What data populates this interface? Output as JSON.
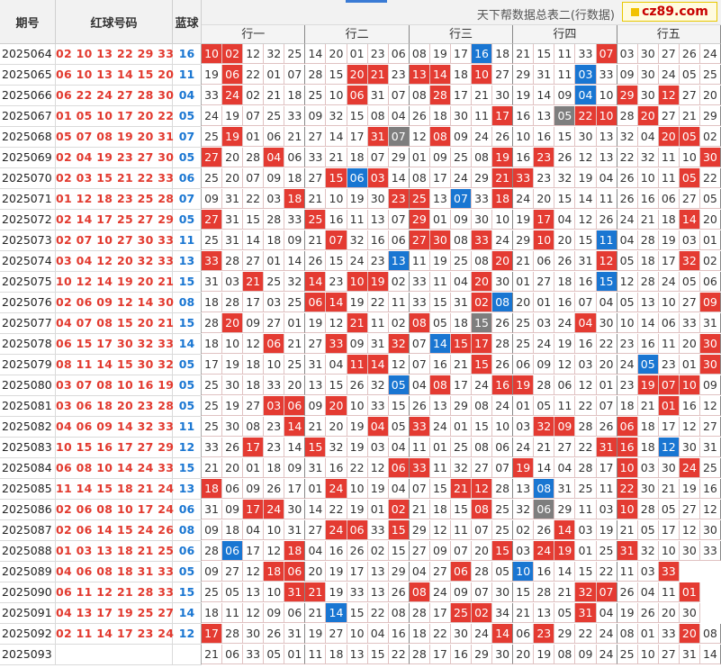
{
  "header": {
    "issue_label": "期号",
    "red_label": "红球号码",
    "blue_label": "蓝球",
    "title": "天下帮数据总表二(行数据)",
    "logo_text": "cz89.com",
    "groups": [
      "行一",
      "行二",
      "行三",
      "行四",
      "行五"
    ]
  },
  "colors": {
    "red_highlight": "#e43b32",
    "blue_highlight": "#1976d2",
    "gray_highlight": "#7e7e7e",
    "red_text": "#e23a2f",
    "blue_text": "#1976d2"
  },
  "rows": [
    {
      "issue": "2025064",
      "red": "02 10 13 22 29 33",
      "blue": "16",
      "cells": [
        "10",
        "02",
        "12",
        "32",
        "25",
        "14",
        "20",
        "01",
        "23",
        "06",
        "08",
        "19",
        "17",
        "16",
        "18",
        "21",
        "15",
        "11",
        "33",
        "07",
        "03",
        "30",
        "27",
        "26",
        "24"
      ],
      "marks": "rr...........b.....r....."
    },
    {
      "issue": "2025065",
      "red": "06 10 13 14 15 20",
      "blue": "11",
      "cells": [
        "19",
        "06",
        "22",
        "01",
        "07",
        "28",
        "15",
        "20",
        "21",
        "23",
        "13",
        "14",
        "18",
        "10",
        "27",
        "29",
        "31",
        "11",
        "03",
        "33",
        "09",
        "30",
        "24",
        "05",
        "25"
      ],
      "marks": ".r.....rr.rr.r....b......"
    },
    {
      "issue": "2025066",
      "red": "06 22 24 27 28 30",
      "blue": "04",
      "cells": [
        "33",
        "24",
        "02",
        "21",
        "18",
        "25",
        "10",
        "06",
        "31",
        "07",
        "08",
        "28",
        "17",
        "21",
        "30",
        "19",
        "14",
        "09",
        "04",
        "10",
        "29",
        "30",
        "12",
        "27",
        "20"
      ],
      "marks": ".r.....r...r......b.r.r."
    },
    {
      "issue": "2025067",
      "red": "01 05 10 17 20 22",
      "blue": "05",
      "cells": [
        "24",
        "19",
        "07",
        "25",
        "33",
        "09",
        "32",
        "15",
        "08",
        "04",
        "26",
        "18",
        "30",
        "11",
        "17",
        "16",
        "13",
        "05",
        "22",
        "10",
        "28",
        "20",
        "27",
        "21",
        "29"
      ],
      "marks": "..............r..grr.r..."
    },
    {
      "issue": "2025068",
      "red": "05 07 08 19 20 31",
      "blue": "07",
      "cells": [
        "25",
        "19",
        "01",
        "06",
        "21",
        "27",
        "14",
        "17",
        "31",
        "07",
        "12",
        "08",
        "09",
        "24",
        "26",
        "10",
        "16",
        "15",
        "30",
        "13",
        "32",
        "04",
        "20",
        "05",
        "02"
      ],
      "marks": ".r......rg.r..........rr."
    },
    {
      "issue": "2025069",
      "red": "02 04 19 23 27 30",
      "blue": "05",
      "cells": [
        "27",
        "20",
        "28",
        "04",
        "06",
        "33",
        "21",
        "18",
        "07",
        "29",
        "01",
        "09",
        "25",
        "08",
        "19",
        "16",
        "23",
        "26",
        "12",
        "13",
        "22",
        "32",
        "11",
        "10",
        "30"
      ],
      "marks": "r..r..........r.r.......r"
    },
    {
      "issue": "2025070",
      "red": "02 03 15 21 22 33",
      "blue": "06",
      "cells": [
        "25",
        "20",
        "07",
        "09",
        "18",
        "27",
        "15",
        "06",
        "03",
        "14",
        "08",
        "17",
        "24",
        "29",
        "21",
        "33",
        "23",
        "32",
        "19",
        "04",
        "26",
        "10",
        "11",
        "05",
        "22"
      ],
      "marks": "......rbr.....rr.......r."
    },
    {
      "issue": "2025071",
      "red": "01 12 18 23 25 28",
      "blue": "07",
      "cells": [
        "09",
        "31",
        "22",
        "03",
        "18",
        "21",
        "10",
        "19",
        "30",
        "23",
        "25",
        "13",
        "07",
        "33",
        "18",
        "24",
        "20",
        "15",
        "14",
        "11",
        "26",
        "16",
        "06",
        "27",
        "05"
      ],
      "marks": "....r....rr.b.r.........."
    },
    {
      "issue": "2025072",
      "red": "02 14 17 25 27 29",
      "blue": "05",
      "cells": [
        "27",
        "31",
        "15",
        "28",
        "33",
        "25",
        "16",
        "11",
        "13",
        "07",
        "29",
        "01",
        "09",
        "30",
        "10",
        "19",
        "17",
        "04",
        "12",
        "26",
        "24",
        "21",
        "18",
        "14",
        "20"
      ],
      "marks": "r....r....r.....r......r."
    },
    {
      "issue": "2025073",
      "red": "02 07 10 27 30 33",
      "blue": "11",
      "cells": [
        "25",
        "31",
        "14",
        "18",
        "09",
        "21",
        "07",
        "32",
        "16",
        "06",
        "27",
        "30",
        "08",
        "33",
        "24",
        "29",
        "10",
        "20",
        "15",
        "11",
        "04",
        "28",
        "19",
        "03",
        "01"
      ],
      "marks": "......r...rr.r..r..b....."
    },
    {
      "issue": "2025074",
      "red": "03 04 12 20 32 33",
      "blue": "13",
      "cells": [
        "33",
        "28",
        "27",
        "01",
        "14",
        "26",
        "15",
        "24",
        "23",
        "13",
        "11",
        "19",
        "25",
        "08",
        "20",
        "21",
        "06",
        "26",
        "31",
        "12",
        "05",
        "18",
        "17",
        "32",
        "02"
      ],
      "marks": "r........b....r....r...r."
    },
    {
      "issue": "2025075",
      "red": "10 12 14 19 20 21",
      "blue": "15",
      "cells": [
        "31",
        "03",
        "21",
        "25",
        "32",
        "14",
        "23",
        "10",
        "19",
        "02",
        "33",
        "11",
        "04",
        "20",
        "30",
        "01",
        "27",
        "18",
        "16",
        "15",
        "12",
        "28",
        "24",
        "05",
        "06"
      ],
      "marks": "..r..r.rr....r.....b....."
    },
    {
      "issue": "2025076",
      "red": "02 06 09 12 14 30",
      "blue": "08",
      "cells": [
        "18",
        "28",
        "17",
        "03",
        "25",
        "06",
        "14",
        "19",
        "22",
        "11",
        "33",
        "15",
        "31",
        "02",
        "08",
        "20",
        "01",
        "16",
        "07",
        "04",
        "05",
        "13",
        "10",
        "27",
        "09"
      ],
      "marks": ".....rr......rb.........r"
    },
    {
      "issue": "2025077",
      "red": "04 07 08 15 20 21",
      "blue": "15",
      "cells": [
        "28",
        "20",
        "09",
        "27",
        "01",
        "19",
        "12",
        "21",
        "11",
        "02",
        "08",
        "05",
        "18",
        "15",
        "26",
        "25",
        "03",
        "24",
        "04",
        "30",
        "10",
        "14",
        "06",
        "33",
        "31"
      ],
      "marks": ".r.....r..r..g....r......"
    },
    {
      "issue": "2025078",
      "red": "06 15 17 30 32 33",
      "blue": "14",
      "cells": [
        "18",
        "10",
        "12",
        "06",
        "21",
        "27",
        "33",
        "09",
        "31",
        "32",
        "07",
        "14",
        "15",
        "17",
        "28",
        "25",
        "24",
        "19",
        "16",
        "22",
        "23",
        "16",
        "11",
        "20",
        "30"
      ],
      "marks": "...r..r..r.brr..........r"
    },
    {
      "issue": "2025079",
      "red": "08 11 14 15 30 32",
      "blue": "05",
      "cells": [
        "17",
        "19",
        "18",
        "10",
        "25",
        "31",
        "04",
        "11",
        "14",
        "12",
        "07",
        "16",
        "21",
        "15",
        "26",
        "06",
        "09",
        "12",
        "03",
        "20",
        "24",
        "05",
        "23",
        "01",
        "30"
      ],
      "marks": ".......rr....r.......b..r"
    },
    {
      "issue": "2025080",
      "red": "03 07 08 10 16 19",
      "blue": "05",
      "cells": [
        "25",
        "30",
        "18",
        "33",
        "20",
        "13",
        "15",
        "26",
        "32",
        "05",
        "04",
        "08",
        "17",
        "24",
        "16",
        "19",
        "28",
        "06",
        "12",
        "01",
        "23",
        "19",
        "07",
        "10",
        "09"
      ],
      "marks": ".........b.r..rr.....rrr."
    },
    {
      "issue": "2025081",
      "red": "03 06 18 20 23 28",
      "blue": "05",
      "cells": [
        "25",
        "19",
        "27",
        "03",
        "06",
        "09",
        "20",
        "10",
        "33",
        "15",
        "26",
        "13",
        "29",
        "08",
        "24",
        "01",
        "05",
        "11",
        "22",
        "07",
        "18",
        "21",
        "01",
        "16",
        "12"
      ],
      "marks": "...rr.r...............r.."
    },
    {
      "issue": "2025082",
      "red": "04 06 09 14 32 33",
      "blue": "11",
      "cells": [
        "25",
        "30",
        "08",
        "23",
        "14",
        "21",
        "20",
        "19",
        "04",
        "05",
        "33",
        "24",
        "01",
        "15",
        "10",
        "03",
        "32",
        "09",
        "28",
        "26",
        "06",
        "18",
        "17",
        "12",
        "27"
      ],
      "marks": "....r...r.r.....rr..r...."
    },
    {
      "issue": "2025083",
      "red": "10 15 16 17 27 29",
      "blue": "12",
      "cells": [
        "33",
        "26",
        "17",
        "23",
        "14",
        "15",
        "32",
        "19",
        "03",
        "04",
        "11",
        "01",
        "25",
        "08",
        "06",
        "24",
        "21",
        "27",
        "22",
        "31",
        "16",
        "18",
        "12",
        "30",
        "31"
      ],
      "marks": "..r..r.............rr.b.."
    },
    {
      "issue": "2025084",
      "red": "06 08 10 14 24 33",
      "blue": "15",
      "cells": [
        "21",
        "20",
        "01",
        "18",
        "09",
        "31",
        "16",
        "22",
        "12",
        "06",
        "33",
        "11",
        "32",
        "27",
        "07",
        "19",
        "14",
        "04",
        "28",
        "17",
        "10",
        "03",
        "30",
        "24",
        "25"
      ],
      "marks": ".........rr....r....r..r."
    },
    {
      "issue": "2025085",
      "red": "11 14 15 18 21 24",
      "blue": "13",
      "cells": [
        "18",
        "06",
        "09",
        "26",
        "17",
        "01",
        "24",
        "10",
        "19",
        "04",
        "07",
        "15",
        "21",
        "12",
        "28",
        "13",
        "08",
        "31",
        "25",
        "11",
        "22",
        "30",
        "21",
        "19",
        "16"
      ],
      "marks": "r.....r.....rr..b...r...."
    },
    {
      "issue": "2025086",
      "red": "02 06 08 10 17 24",
      "blue": "06",
      "cells": [
        "31",
        "09",
        "17",
        "24",
        "30",
        "14",
        "22",
        "19",
        "01",
        "02",
        "21",
        "18",
        "15",
        "08",
        "25",
        "32",
        "06",
        "29",
        "11",
        "03",
        "10",
        "28",
        "05",
        "27",
        "12"
      ],
      "marks": "..rr.....r...r..g...r...."
    },
    {
      "issue": "2025087",
      "red": "02 06 14 15 24 26",
      "blue": "08",
      "cells": [
        "09",
        "18",
        "04",
        "10",
        "31",
        "27",
        "24",
        "06",
        "33",
        "15",
        "29",
        "12",
        "11",
        "07",
        "25",
        "02",
        "26",
        "14",
        "03",
        "19",
        "21",
        "05",
        "17",
        "12",
        "30"
      ],
      "marks": "......rr.r.......r......."
    },
    {
      "issue": "2025088",
      "red": "01 03 13 18 21 25",
      "blue": "06",
      "cells": [
        "28",
        "06",
        "17",
        "12",
        "18",
        "04",
        "16",
        "26",
        "02",
        "15",
        "27",
        "09",
        "07",
        "20",
        "15",
        "03",
        "24",
        "19",
        "01",
        "25",
        "31",
        "32",
        "10",
        "30",
        "33"
      ],
      "marks": ".b..r.........r.rr..r...."
    },
    {
      "issue": "2025089",
      "red": "04 06 08 18 31 33",
      "blue": "05",
      "cells": [
        "09",
        "27",
        "12",
        "18",
        "06",
        "20",
        "19",
        "17",
        "13",
        "29",
        "04",
        "27",
        "06",
        "28",
        "05",
        "10",
        "16",
        "14",
        "15",
        "22",
        "11",
        "03",
        "33"
      ],
      "marks": "...rr.......r..b......r."
    },
    {
      "issue": "2025090",
      "red": "06 11 12 21 28 33",
      "blue": "15",
      "cells": [
        "25",
        "05",
        "13",
        "10",
        "31",
        "21",
        "19",
        "33",
        "13",
        "26",
        "08",
        "24",
        "09",
        "07",
        "30",
        "15",
        "28",
        "21",
        "32",
        "07",
        "26",
        "04",
        "11",
        "01"
      ],
      "marks": "....rr....r.......rr...r."
    },
    {
      "issue": "2025091",
      "red": "04 13 17 19 25 27",
      "blue": "14",
      "cells": [
        "18",
        "11",
        "12",
        "09",
        "06",
        "21",
        "14",
        "15",
        "22",
        "08",
        "28",
        "17",
        "25",
        "02",
        "34",
        "21",
        "13",
        "05",
        "31",
        "04",
        "19",
        "26",
        "20",
        "30"
      ],
      "marks": "......b.....rr....r......"
    },
    {
      "issue": "2025092",
      "red": "02 11 14 17 23 24",
      "blue": "12",
      "cells": [
        "17",
        "28",
        "30",
        "26",
        "31",
        "19",
        "27",
        "10",
        "04",
        "16",
        "18",
        "22",
        "30",
        "24",
        "14",
        "06",
        "23",
        "29",
        "22",
        "24",
        "08",
        "01",
        "33",
        "20",
        "08"
      ],
      "marks": "r.............r.r......r."
    },
    {
      "issue": "2025093",
      "red": "",
      "blue": "",
      "cells": [
        "21",
        "06",
        "33",
        "05",
        "01",
        "11",
        "18",
        "13",
        "15",
        "22",
        "28",
        "17",
        "16",
        "29",
        "30",
        "20",
        "19",
        "08",
        "09",
        "24",
        "25",
        "10",
        "27",
        "31",
        "14"
      ],
      "marks": "........................."
    }
  ]
}
